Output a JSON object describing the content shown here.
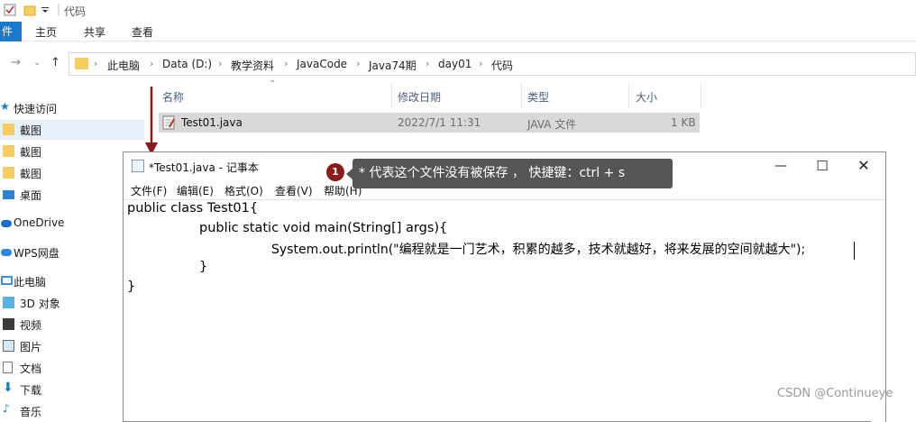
{
  "titlebar": {
    "title": "代码",
    "icons": [
      "properties-icon",
      "new-folder-icon",
      "quick-access-dropdown-icon"
    ]
  },
  "ribbon": {
    "file_tab": "件",
    "tabs": [
      "主页",
      "共享",
      "查看"
    ]
  },
  "address_bar": {
    "crumbs": [
      "此电脑",
      "Data (D:)",
      "教学资料",
      "JavaCode",
      "Java74期",
      "day01",
      "代码"
    ]
  },
  "nav_pane": {
    "items": [
      {
        "label": "快速访问",
        "icon": "star-icon"
      },
      {
        "label": "截图",
        "icon": "folder-icon"
      },
      {
        "label": "截图",
        "icon": "folder-icon"
      },
      {
        "label": "截图",
        "icon": "folder-icon"
      },
      {
        "label": "桌面",
        "icon": "desktop-icon"
      },
      {
        "label": "OneDrive",
        "icon": "cloud-icon"
      },
      {
        "label": "WPS网盘",
        "icon": "cloud-icon"
      },
      {
        "label": "此电脑",
        "icon": "computer-icon"
      },
      {
        "label": "3D 对象",
        "icon": "cube-icon"
      },
      {
        "label": "视频",
        "icon": "video-icon"
      },
      {
        "label": "图片",
        "icon": "picture-icon"
      },
      {
        "label": "文档",
        "icon": "document-icon"
      },
      {
        "label": "下载",
        "icon": "download-icon"
      },
      {
        "label": "音乐",
        "icon": "music-icon"
      }
    ]
  },
  "file_list": {
    "columns": [
      "名称",
      "修改日期",
      "类型",
      "大小"
    ],
    "rows": [
      {
        "name": "Test01.java",
        "modified": "2022/7/1 11:31",
        "type": "JAVA 文件",
        "size": "1 KB"
      }
    ]
  },
  "notepad": {
    "title": "*Test01.java - 记事本",
    "menus": [
      "文件(F)",
      "编辑(E)",
      "格式(O)",
      "查看(V)",
      "帮助(H)"
    ],
    "lines": [
      "public class Test01{",
      "public static void main(String[] args){",
      "System.out.println(\"编程就是一门艺术，积累的越多，技术就越好，将来发展的空间就越大\");",
      "}",
      "}"
    ]
  },
  "annotation": {
    "badge": "1",
    "text": "* 代表这个文件没有被保存 ， 快捷键：ctrl + s"
  },
  "watermark": "CSDN @Continueye",
  "colors": {
    "accent": "#1979ca",
    "annotation_badge": "#8b1a1a",
    "tooltip": "#555555",
    "selection": "#d9d9d9"
  }
}
